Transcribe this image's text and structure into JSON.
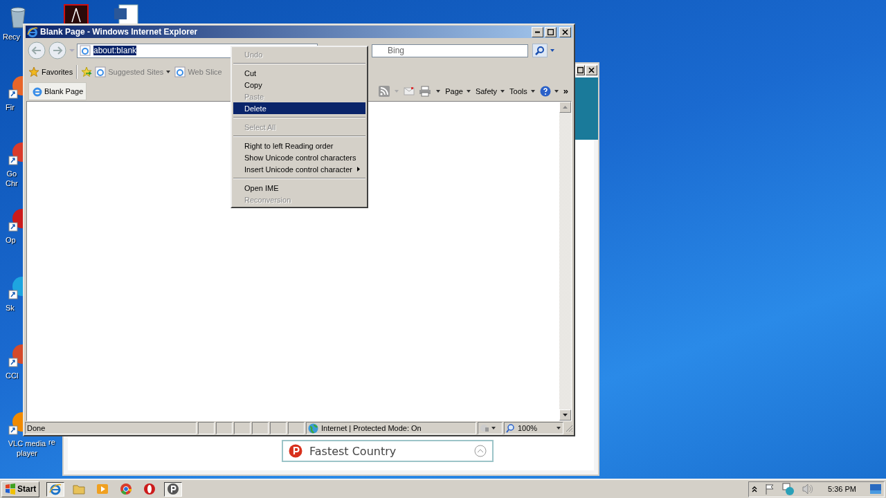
{
  "desktop_icons": [
    {
      "kind": "recycle",
      "label": "Recy"
    },
    {
      "kind": "pdf"
    },
    {
      "kind": "word"
    },
    {
      "kind": "firefox",
      "label": "Fir"
    },
    {
      "kind": "chrome",
      "label": "Go Chr"
    },
    {
      "kind": "opera",
      "label": "Op"
    },
    {
      "kind": "skype",
      "label": "Sk"
    },
    {
      "kind": "ccleaner",
      "label": "CCl"
    },
    {
      "kind": "vlc",
      "label": "VLC media player"
    },
    {
      "kind": "file",
      "label": "re"
    }
  ],
  "back_window": {
    "panel_label": "Fastest Country"
  },
  "window": {
    "title": "Blank Page - Windows Internet Explorer",
    "address": "about:blank",
    "search": {
      "placeholder": "Bing"
    },
    "favorites_bar": [
      {
        "label": "Favorites",
        "kind": "star"
      },
      {
        "label": "Suggested Sites",
        "kind": "site"
      },
      {
        "label": "Web Slice",
        "kind": "slice"
      }
    ],
    "tab": {
      "label": "Blank Page"
    },
    "command_bar": [
      {
        "label": "Page"
      },
      {
        "label": "Safety"
      },
      {
        "label": "Tools"
      }
    ],
    "overflow": "»",
    "status_bar": {
      "text": "Done",
      "zone": "Internet | Protected Mode: On",
      "zoom": "100%"
    }
  },
  "context_menu": {
    "items": [
      {
        "kind": "item",
        "label": "Undo",
        "disabled": true,
        "selected": false
      },
      {
        "kind": "separator"
      },
      {
        "kind": "item",
        "label": "Cut",
        "disabled": false,
        "selected": false
      },
      {
        "kind": "item",
        "label": "Copy",
        "disabled": false,
        "selected": false
      },
      {
        "kind": "item",
        "label": "Paste",
        "disabled": true,
        "selected": false
      },
      {
        "kind": "item",
        "label": "Delete",
        "disabled": false,
        "selected": true
      },
      {
        "kind": "separator"
      },
      {
        "kind": "item",
        "label": "Select All",
        "disabled": true,
        "selected": false
      },
      {
        "kind": "separator"
      },
      {
        "kind": "item",
        "label": "Right to left Reading order",
        "disabled": false,
        "selected": false
      },
      {
        "kind": "item",
        "label": "Show Unicode control characters",
        "disabled": false,
        "selected": false
      },
      {
        "kind": "item",
        "label": "Insert Unicode control character",
        "disabled": false,
        "selected": false,
        "submenu": true
      },
      {
        "kind": "separator"
      },
      {
        "kind": "item",
        "label": "Open IME",
        "disabled": false,
        "selected": false
      },
      {
        "kind": "item",
        "label": "Reconversion",
        "disabled": true,
        "selected": false
      }
    ]
  },
  "taskbar": {
    "start": "Start",
    "buttons": [
      {
        "kind": "ie",
        "active": true
      },
      {
        "kind": "folder",
        "active": false
      },
      {
        "kind": "media",
        "active": false
      },
      {
        "kind": "chrome",
        "active": false
      },
      {
        "kind": "opera",
        "active": false
      },
      {
        "kind": "psiphon",
        "active": true
      }
    ],
    "clock": "5:36 PM"
  }
}
